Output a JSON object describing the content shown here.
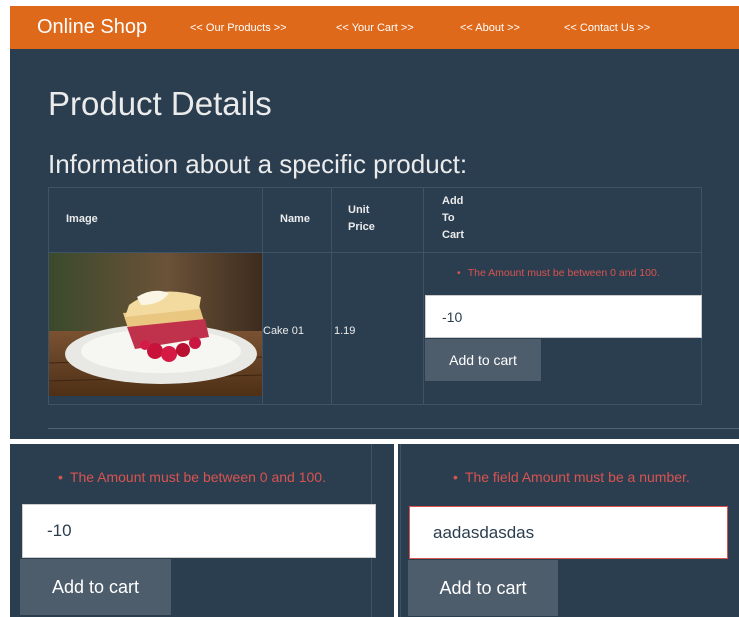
{
  "navbar": {
    "brand": "Online Shop",
    "links": [
      "<< Our Products >>",
      "<< Your Cart >>",
      "<< About >>",
      "<< Contact Us >>"
    ]
  },
  "page": {
    "title": "Product Details",
    "subtitle": "Information about a specific product:"
  },
  "table": {
    "headers": [
      "Image",
      "Name",
      "Unit Price",
      "Add To Cart"
    ],
    "row": {
      "name": "Cake 01",
      "unit_price": "1.19"
    }
  },
  "form_top": {
    "error": "The Amount must be between 0 and 100.",
    "amount_value": "-10",
    "button_label": "Add to cart"
  },
  "form_range_error": {
    "error": "The Amount must be between 0 and 100.",
    "amount_value": "-10",
    "button_label": "Add to cart"
  },
  "form_number_error": {
    "error": "The field Amount must be a number.",
    "amount_value": "aadasdasdas",
    "button_label": "Add to cart"
  },
  "colors": {
    "navbar": "#df691a",
    "background": "#2b3e50",
    "error": "#d9534f",
    "button": "#4e5d6c"
  }
}
